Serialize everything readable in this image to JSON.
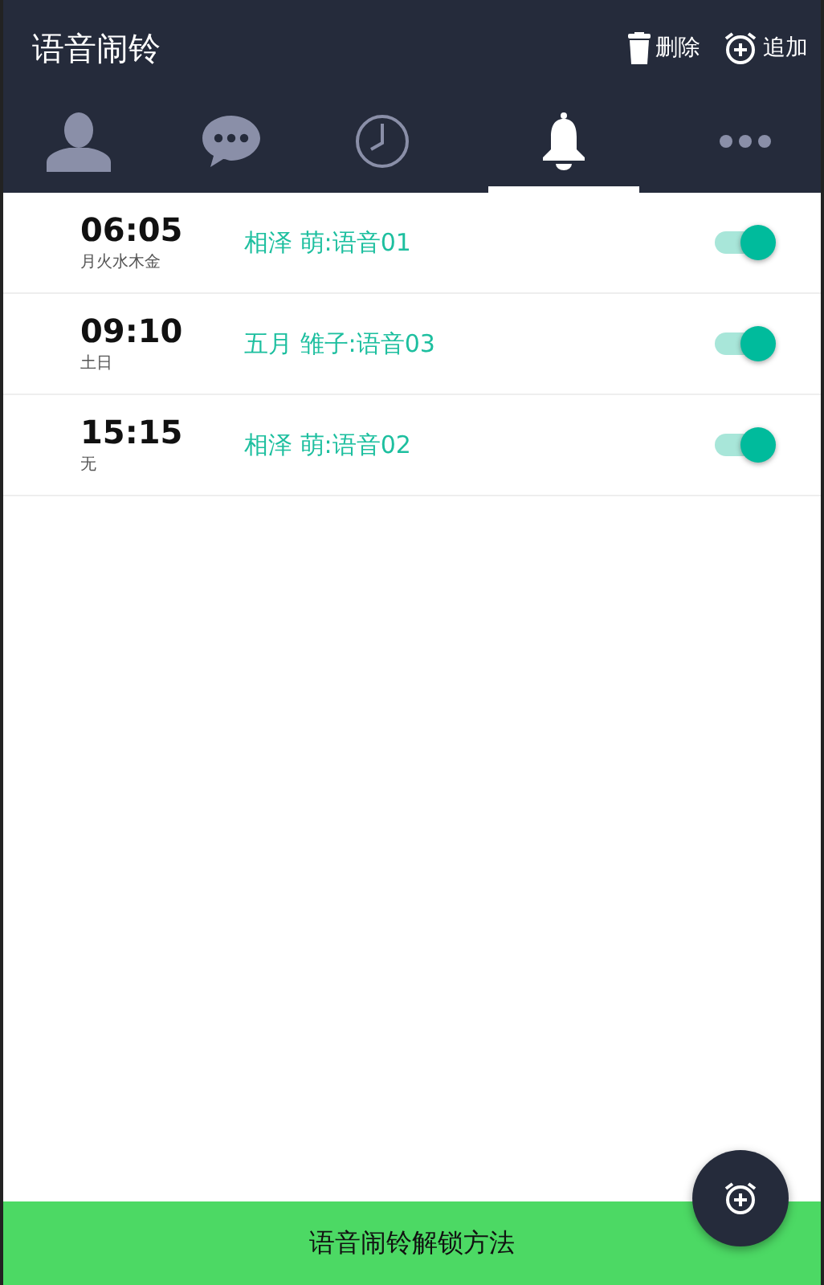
{
  "app_bar": {
    "title": "语音闹铃",
    "actions": [
      {
        "kind": "delete",
        "label": "删除"
      },
      {
        "kind": "add",
        "label": "追加"
      }
    ]
  },
  "tabs": [
    {
      "kind": "person",
      "selected": false
    },
    {
      "kind": "chat",
      "selected": false
    },
    {
      "kind": "clock",
      "selected": false
    },
    {
      "kind": "bell",
      "selected": true
    },
    {
      "kind": "more",
      "selected": false
    }
  ],
  "alarms": [
    {
      "time": "06:05",
      "days": "月火水木金",
      "voice": "相泽 萌:语音01",
      "on": true
    },
    {
      "time": "09:10",
      "days": "土日",
      "voice": "五月 雏子:语音03",
      "on": true
    },
    {
      "time": "15:15",
      "days": "无",
      "voice": "相泽 萌:语音02",
      "on": true
    }
  ],
  "bottom_bar": {
    "label": "语音闹铃解锁方法"
  },
  "fab": {
    "kind": "add"
  }
}
